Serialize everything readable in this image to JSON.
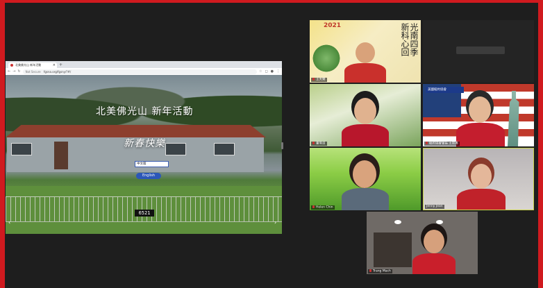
{
  "browser": {
    "tab_title": "北美佛光山 新年活動",
    "new_tab": "+",
    "url_prefix": "Not Secure",
    "url": "fgsna.org/fgsny/?#/"
  },
  "site": {
    "title": "北美佛光山  新年活動",
    "greeting": "新春快樂",
    "chinese_button": "中文版",
    "english_button": "English",
    "visit_counter": "6521"
  },
  "participants": [
    {
      "name": "王天樂",
      "poster_year": "2021",
      "poster_text": "光南四季 新科心回"
    },
    {
      "name": ""
    },
    {
      "name": "董雪貞"
    },
    {
      "name": "紐約協會會長 王如惠",
      "banner": "美國紐約協會"
    },
    {
      "name": "Helen Chin"
    },
    {
      "name": "Jenny Jean"
    },
    {
      "name": "Trang Mach"
    }
  ],
  "colors": {
    "frame": "#d01a1f",
    "active_speaker": "#c9d34a"
  }
}
